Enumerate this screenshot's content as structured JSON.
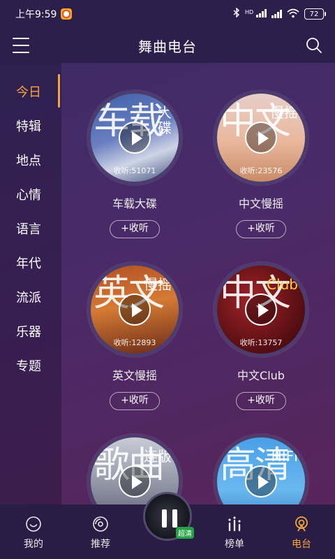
{
  "status": {
    "time": "上午9:59",
    "network_tag": "HD",
    "battery": "72"
  },
  "header": {
    "title": "舞曲电台"
  },
  "sidebar": {
    "items": [
      {
        "label": "今日"
      },
      {
        "label": "特辑"
      },
      {
        "label": "地点"
      },
      {
        "label": "心情"
      },
      {
        "label": "语言"
      },
      {
        "label": "年代"
      },
      {
        "label": "流派"
      },
      {
        "label": "乐器"
      },
      {
        "label": "专题"
      }
    ],
    "active": "今日"
  },
  "cards": [
    {
      "name": "车载大碟",
      "big": "车载",
      "small": "大\n碟",
      "plays": "收听:51071",
      "button": "+收听"
    },
    {
      "name": "中文慢摇",
      "big": "中文",
      "small": "慢摇",
      "plays": "收听:23576",
      "button": "+收听"
    },
    {
      "name": "英文慢摇",
      "big": "英文",
      "small": "慢摇",
      "plays": "收听:12893",
      "button": "+收听"
    },
    {
      "name": "中文Club",
      "big": "中文",
      "small": "Club",
      "plays": "收听:13757",
      "button": "+收听"
    },
    {
      "name": "",
      "big": "歌曲",
      "small": "连版",
      "plays": "",
      "button": ""
    },
    {
      "name": "",
      "big": "高清",
      "small": "HIFI",
      "plays": "",
      "button": ""
    }
  ],
  "bottom_nav": {
    "items": [
      {
        "label": "我的",
        "icon": "smile-icon"
      },
      {
        "label": "推荐",
        "icon": "disc-icon"
      },
      {
        "label": "",
        "icon": "now-playing-disc"
      },
      {
        "label": "榜单",
        "icon": "chart-icon"
      },
      {
        "label": "电台",
        "icon": "radio-icon"
      }
    ],
    "active": "电台",
    "player_badge": "超清"
  },
  "colors": {
    "accent": "#f5a53a",
    "header_bg": "#2c1f4c",
    "nav_bg": "#2a1d45"
  }
}
